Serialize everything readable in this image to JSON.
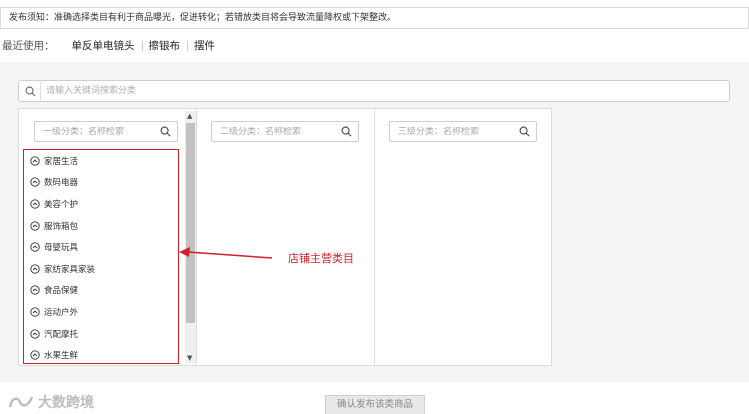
{
  "notice": "发布须知：准确选择类目有利于商品曝光，促进转化；若错放类目将会导致流量降权或下架整改。",
  "recent": {
    "label": "最近使用：",
    "items": [
      "单反单电镜头",
      "擦银布",
      "摆件"
    ]
  },
  "search": {
    "placeholder": "请输入关键词搜索分类"
  },
  "columns": [
    {
      "placeholder": "一级分类：名称检索"
    },
    {
      "placeholder": "二级分类：名称检索"
    },
    {
      "placeholder": "三级分类：名称检索"
    }
  ],
  "categories": [
    "家居生活",
    "数码电器",
    "美容个护",
    "服饰箱包",
    "母婴玩具",
    "家纺家具家装",
    "食品保健",
    "运动户外",
    "汽配摩托",
    "水果生鲜"
  ],
  "annotation": "店铺主营类目",
  "confirm_button": "确认发布该类商品",
  "watermark": "大数跨境",
  "colors": {
    "annotation": "#d0202c"
  }
}
